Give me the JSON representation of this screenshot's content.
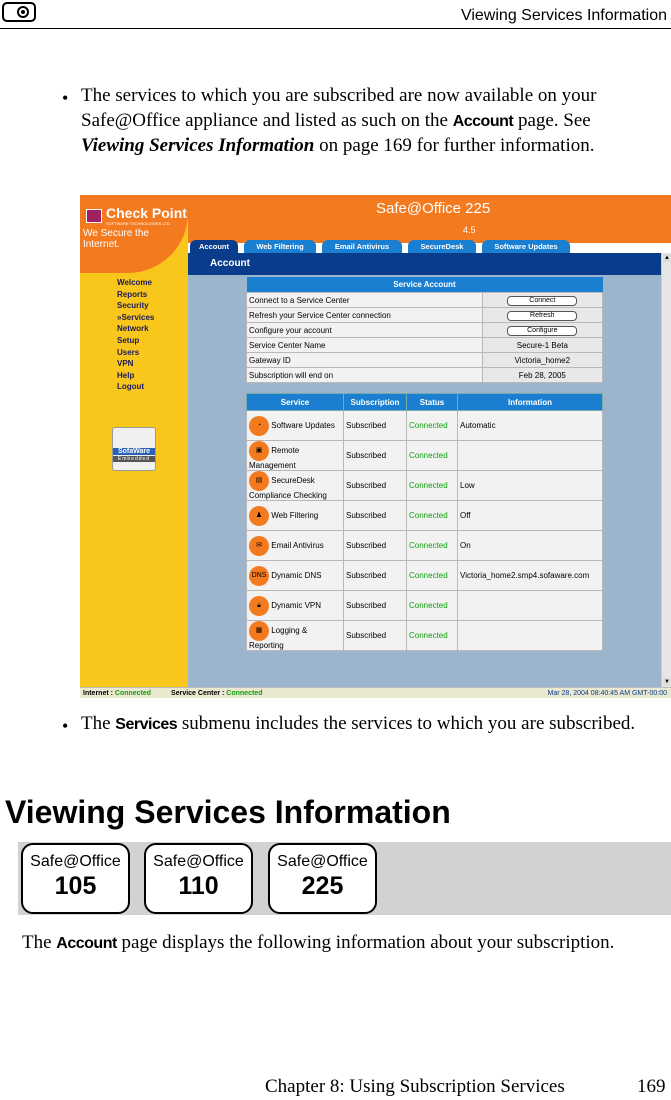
{
  "header": {
    "title": "Viewing Services Information"
  },
  "bullet1": {
    "symbol": "•",
    "t1": "The services to which you are subscribed are now available on your Safe@Office appliance and listed as such on the ",
    "term": "Account",
    "t2": " page. See ",
    "xref": "Viewing Services Information",
    "t3": " on page 169 for further information."
  },
  "screenshot": {
    "logo_name": "Check Point",
    "logo_sub": "SOFTWARE TECHNOLOGIES LTD.",
    "tagline": "We Secure the Internet.",
    "product": "Safe@Office 225",
    "version": "4.5",
    "tabs": [
      "Account",
      "Web Filtering",
      "Email Antivirus",
      "SecureDesk",
      "Software Updates"
    ],
    "page_title": "Account",
    "menu": [
      "Welcome",
      "Reports",
      "Security",
      "»Services",
      "Network",
      "Setup",
      "Users",
      "VPN",
      "Help",
      "Logout"
    ],
    "sofaware": {
      "name": "SofaWare",
      "sub": "Embedded"
    },
    "account_table": {
      "title": "Service Account",
      "rows": [
        {
          "label": "Connect to a Service Center",
          "button": "Connect"
        },
        {
          "label": "Refresh your Service Center connection",
          "button": "Refresh"
        },
        {
          "label": "Configure your account",
          "button": "Configure"
        },
        {
          "label": "Service Center Name",
          "value": "Secure-1 Beta"
        },
        {
          "label": "Gateway ID",
          "value": "Victoria_home2"
        },
        {
          "label": "Subscription will end on",
          "value": "Feb 28, 2005"
        }
      ]
    },
    "services_table": {
      "headers": [
        "Service",
        "Subscription",
        "Status",
        "Information"
      ],
      "rows": [
        {
          "icon": "clock-icon",
          "glyph": "◔",
          "service": "Software Updates",
          "sub": "Subscribed",
          "status": "Connected",
          "info": "Automatic"
        },
        {
          "icon": "remote-icon",
          "glyph": "▣",
          "service": "Remote Management",
          "sub": "Subscribed",
          "status": "Connected",
          "info": ""
        },
        {
          "icon": "lock-doc-icon",
          "glyph": "▤",
          "service": "SecureDesk Compliance Checking",
          "sub": "Subscribed",
          "status": "Connected",
          "info": "Low"
        },
        {
          "icon": "family-icon",
          "glyph": "♟",
          "service": "Web Filtering",
          "sub": "Subscribed",
          "status": "Connected",
          "info": "Off"
        },
        {
          "icon": "email-icon",
          "glyph": "✉",
          "service": "Email Antivirus",
          "sub": "Subscribed",
          "status": "Connected",
          "info": "On"
        },
        {
          "icon": "dns-icon",
          "glyph": "DNS",
          "service": "Dynamic DNS",
          "sub": "Subscribed",
          "status": "Connected",
          "info": "Victoria_home2.smp4.sofaware.com"
        },
        {
          "icon": "padlock-icon",
          "glyph": "🔒︎",
          "service": "Dynamic VPN",
          "sub": "Subscribed",
          "status": "Connected",
          "info": ""
        },
        {
          "icon": "report-icon",
          "glyph": "▦",
          "service": "Logging & Reporting",
          "sub": "Subscribed",
          "status": "Connected",
          "info": ""
        }
      ]
    },
    "statusbar": {
      "internet_label": "Internet :",
      "internet_value": "Connected",
      "center_label": "Service Center :",
      "center_value": "Connected",
      "datetime": "Mar 28, 2004 08:40:45 AM GMT-00:00"
    }
  },
  "bullet2": {
    "symbol": "•",
    "t1": "The ",
    "term": "Services",
    "t2": " submenu includes the services to which you are subscribed."
  },
  "section": {
    "heading": "Viewing Services Information"
  },
  "badges": [
    {
      "name": "Safe@Office",
      "model": "105"
    },
    {
      "name": "Safe@Office",
      "model": "110"
    },
    {
      "name": "Safe@Office",
      "model": "225"
    }
  ],
  "para": {
    "t1": "The ",
    "term": "Account",
    "t2": " page displays the following information about your subscription."
  },
  "footer": {
    "chapter": "Chapter 8: Using Subscription Services",
    "page": "169"
  }
}
